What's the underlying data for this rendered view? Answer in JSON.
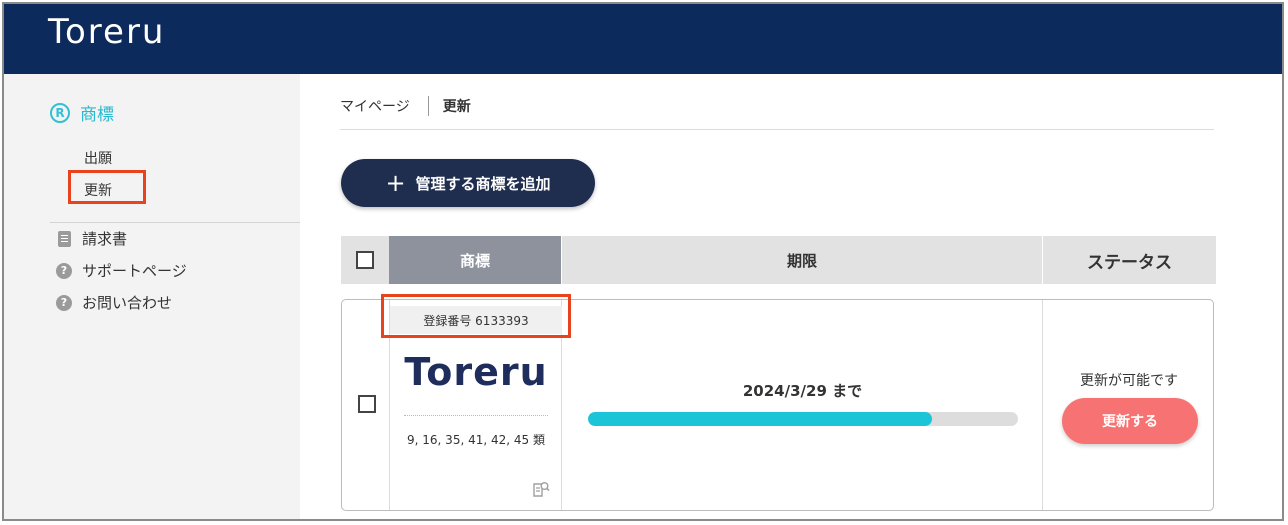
{
  "header": {
    "logo_text": "Toreru",
    "bg_color": "#0d2a5c"
  },
  "sidebar": {
    "category": {
      "icon_letter": "R",
      "label": "商標",
      "color": "#29b8cf"
    },
    "sub_items": [
      {
        "label": "出願"
      },
      {
        "label": "更新",
        "highlighted": true
      }
    ],
    "links": [
      {
        "label": "請求書",
        "icon": "document-icon"
      },
      {
        "label": "サポートページ",
        "icon": "question-icon"
      },
      {
        "label": "お問い合わせ",
        "icon": "question-icon"
      }
    ]
  },
  "breadcrumb": {
    "parent": "マイページ",
    "current": "更新"
  },
  "add_button": {
    "label": "管理する商標を追加",
    "icon": "plus-icon"
  },
  "table": {
    "headers": {
      "mark": "商標",
      "deadline": "期限",
      "status": "ステータス"
    },
    "rows": [
      {
        "registration_number": "登録番号 6133393",
        "mark_logo": "Toreru",
        "classes": "9, 16, 35, 41, 42, 45 類",
        "deadline": "2024/3/29 まで",
        "progress": 0.8,
        "status": "更新が可能です",
        "action_label": "更新する"
      }
    ]
  },
  "colors": {
    "accent": "#1bc4d6",
    "highlight_box": "#e8431d",
    "renew_button": "#f77373",
    "add_button": "#1f2d4e"
  }
}
